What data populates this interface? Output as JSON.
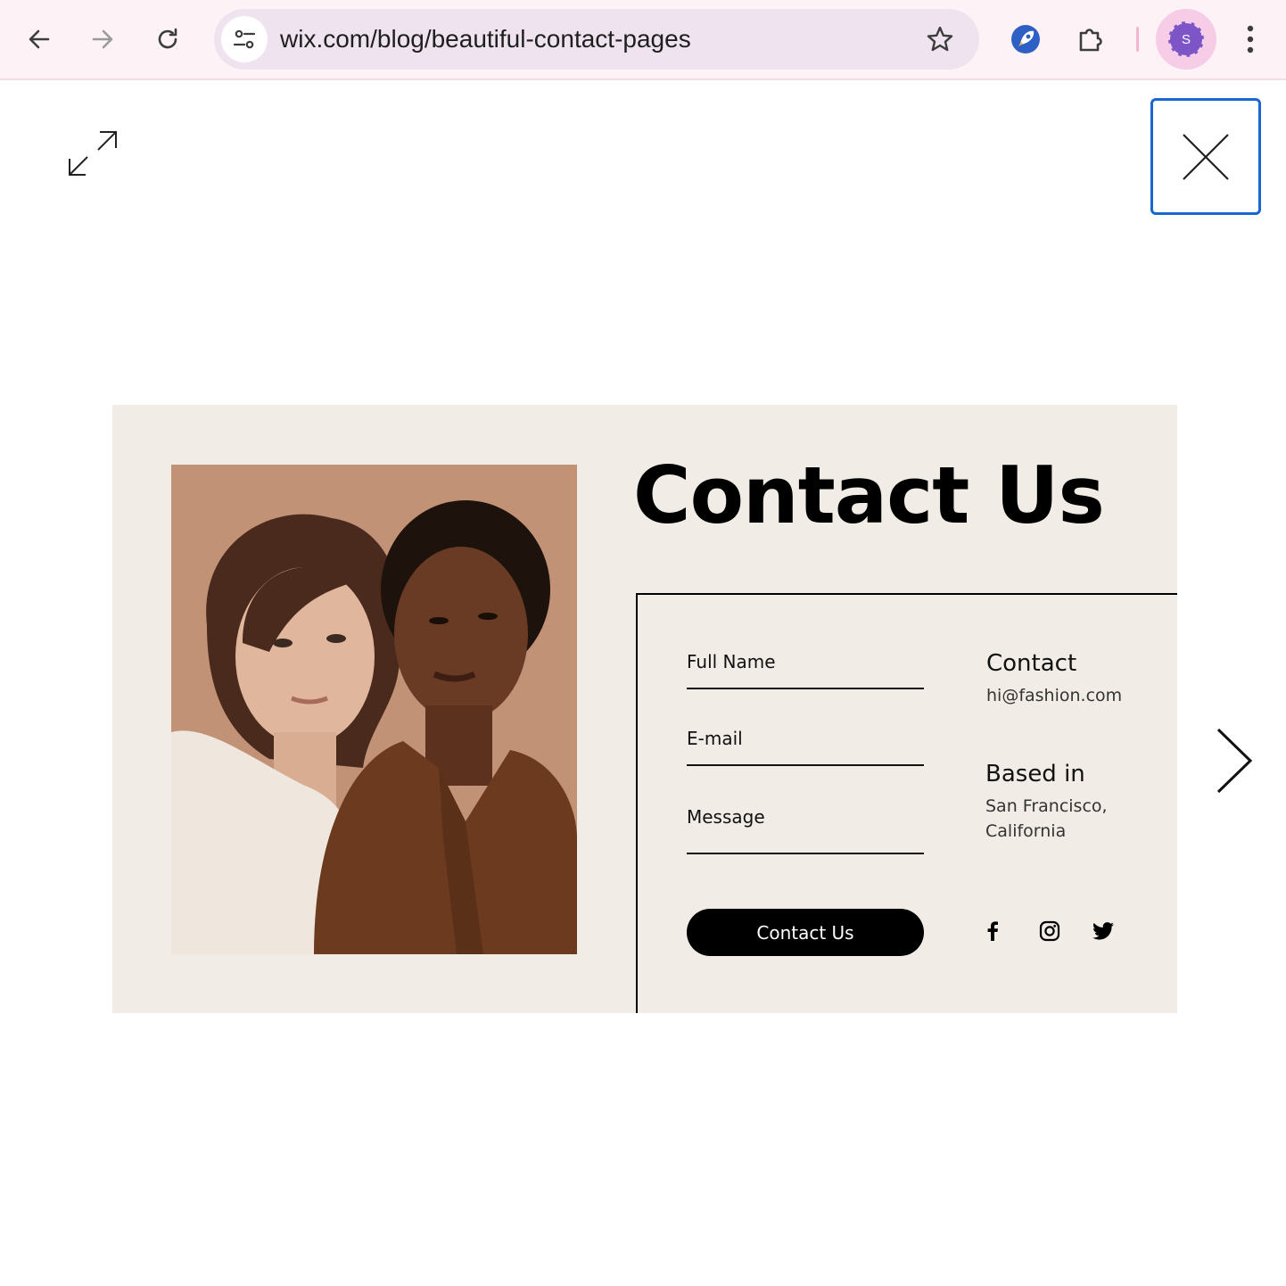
{
  "browser": {
    "url": "wix.com/blog/beautiful-contact-pages",
    "profile_initial": "S",
    "icons": {
      "back": "arrow-left-icon",
      "forward": "arrow-right-icon",
      "reload": "reload-icon",
      "site_info": "tune-icon",
      "bookmark": "star-icon",
      "extension": "rocket-icon",
      "extensions_menu": "puzzle-icon",
      "menu": "more-vertical-icon"
    }
  },
  "lightbox": {
    "icons": {
      "expand": "expand-icon",
      "close": "close-icon",
      "next": "chevron-right-icon"
    }
  },
  "slide": {
    "headline": "Contact Us",
    "form": {
      "full_name_label": "Full Name",
      "email_label": "E-mail",
      "message_label": "Message",
      "submit_label": "Contact Us"
    },
    "info": {
      "contact_title": "Contact",
      "contact_email": "hi@fashion.com",
      "based_title": "Based in",
      "city_line1": "San Francisco,",
      "city_line2": "California"
    },
    "social": [
      "facebook-icon",
      "instagram-icon",
      "twitter-icon"
    ],
    "colors": {
      "background": "#f1ece6",
      "button": "#000000",
      "photo_tone": "#b9876a"
    }
  }
}
